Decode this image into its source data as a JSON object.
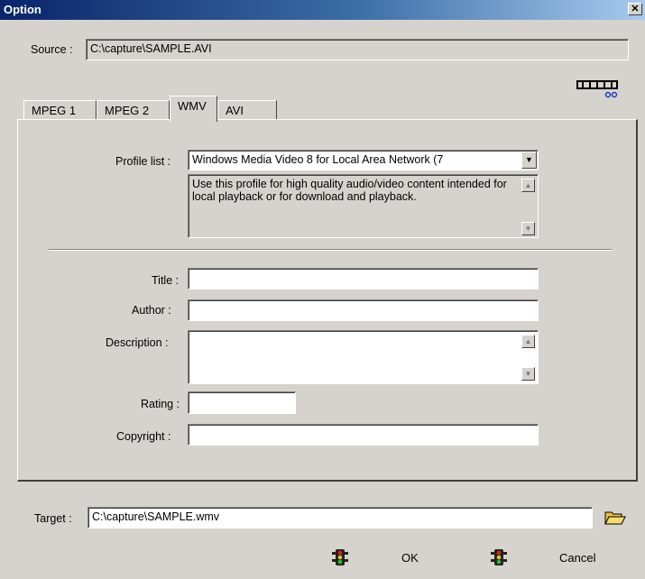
{
  "window": {
    "title": "Option",
    "close_glyph": "✕"
  },
  "source": {
    "label": "Source :",
    "value": "C:\\capture\\SAMPLE.AVI"
  },
  "tabs": [
    {
      "label": "MPEG 1"
    },
    {
      "label": "MPEG 2"
    },
    {
      "label": "WMV",
      "active": true
    },
    {
      "label": "AVI"
    }
  ],
  "wmv": {
    "profile_label": "Profile list :",
    "profile_value": "Windows Media Video 8 for Local Area Network (7",
    "profile_description": "Use this profile for high quality audio/video content intended for local playback or for download and playback.",
    "title_label": "Title :",
    "title_value": "",
    "author_label": "Author :",
    "author_value": "",
    "description_label": "Description :",
    "description_value": "",
    "rating_label": "Rating :",
    "rating_value": "",
    "copyright_label": "Copyright :",
    "copyright_value": ""
  },
  "target": {
    "label": "Target :",
    "value": "C:\\capture\\SAMPLE.wmv"
  },
  "buttons": {
    "ok": "OK",
    "cancel": "Cancel"
  },
  "icons": {
    "film_settings": "film-strip-icon",
    "browse": "open-folder-icon",
    "ok": "traffic-light-icon",
    "cancel": "traffic-light-icon"
  }
}
